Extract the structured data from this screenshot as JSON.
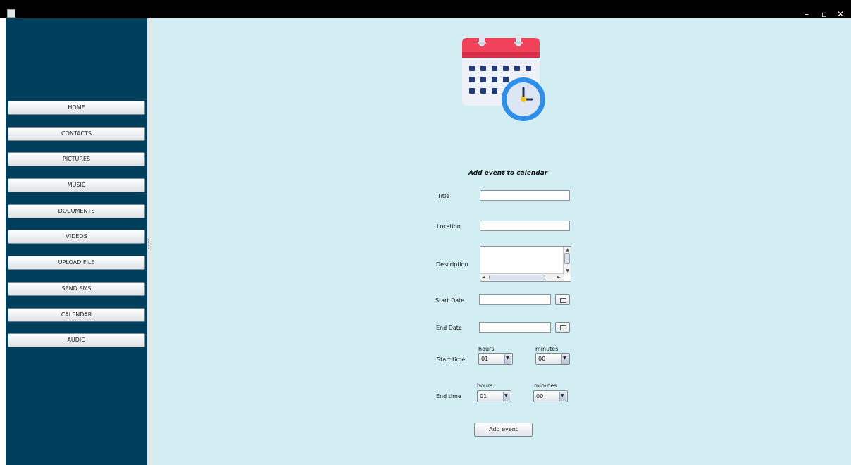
{
  "titlebar": {
    "minimize_glyph": "–",
    "restore_glyph": "▫",
    "close_glyph": "✕"
  },
  "sidebar": {
    "items": [
      {
        "label": "HOME"
      },
      {
        "label": "CONTACTS"
      },
      {
        "label": "PICTURES"
      },
      {
        "label": "MUSIC"
      },
      {
        "label": "DOCUMENTS"
      },
      {
        "label": "VIDEOS"
      },
      {
        "label": "UPLOAD FILE"
      },
      {
        "label": "SEND SMS"
      },
      {
        "label": "CALENDAR"
      },
      {
        "label": "AUDIO"
      }
    ],
    "active": "CALENDAR"
  },
  "form": {
    "icon": "calendar-clock-icon",
    "heading": "Add event to calendar",
    "title_label": "Title",
    "title_value": "",
    "location_label": "Location",
    "location_value": "",
    "description_label": "Description",
    "description_value": "",
    "start_date_label": "Start Date",
    "start_date_value": "",
    "end_date_label": "End Date",
    "end_date_value": "",
    "start_time_label": "Start time",
    "end_time_label": "End time",
    "hours_label": "hours",
    "minutes_label": "minutes",
    "start_hours": "01",
    "start_minutes": "00",
    "end_hours": "01",
    "end_minutes": "00",
    "submit_label": "Add event"
  },
  "colors": {
    "sidebar_bg": "#003f5c",
    "main_bg": "#d2eef2",
    "titlebar_bg": "#000000",
    "calendar_red": "#f0435a",
    "clock_blue": "#2f8fe8"
  }
}
